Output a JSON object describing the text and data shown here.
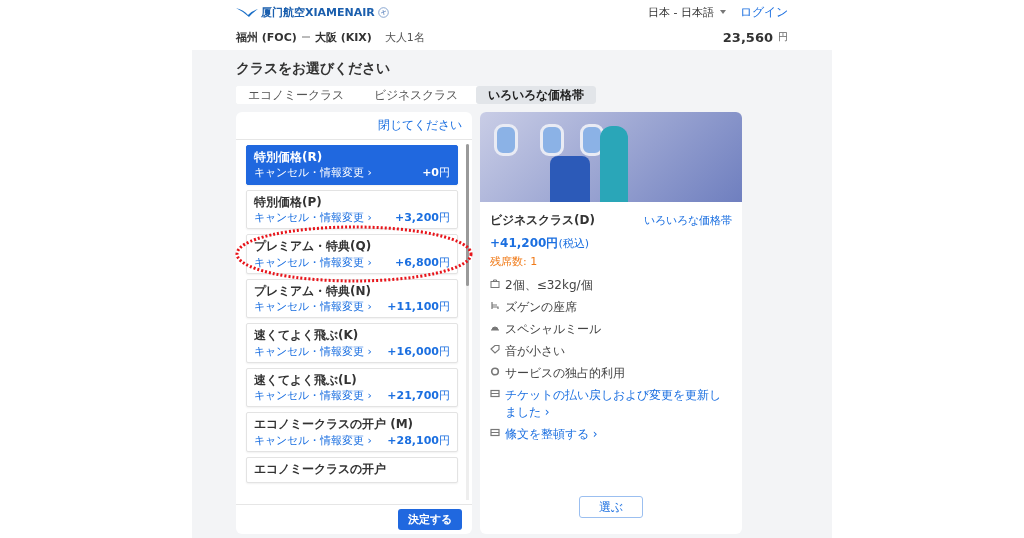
{
  "header": {
    "logo_text": "厦门航空XIAMENAIR",
    "language": "日本 - 日本語",
    "login": "ログイン"
  },
  "trip": {
    "origin": "福州 (FOC)",
    "destination": "大阪 (KIX)",
    "passengers": "大人1名",
    "total": "23,560",
    "currency": "円"
  },
  "title": "クラスをお選びください",
  "tabs": [
    {
      "label": "エコノミークラス",
      "selected": false
    },
    {
      "label": "ビジネスクラス",
      "selected": false
    },
    {
      "label": "いろいろな価格帯",
      "selected": true
    }
  ],
  "fare_panel": {
    "close_link": "閉じてください",
    "confirm_button": "決定する",
    "fares": [
      {
        "name": "特別価格(R)",
        "link": "キャンセル・情報変更 ›",
        "price": "+0",
        "unit": "円",
        "selected": true
      },
      {
        "name": "特別価格(P)",
        "link": "キャンセル・情報変更 ›",
        "price": "+3,200",
        "unit": "円",
        "selected": false
      },
      {
        "name": "プレミアム・特典(Q)",
        "link": "キャンセル・情報変更 ›",
        "price": "+6,800",
        "unit": "円",
        "selected": false
      },
      {
        "name": "プレミアム・特典(N)",
        "link": "キャンセル・情報変更 ›",
        "price": "+11,100",
        "unit": "円",
        "selected": false
      },
      {
        "name": "速くてよく飛ぶ(K)",
        "link": "キャンセル・情報変更 ›",
        "price": "+16,000",
        "unit": "円",
        "selected": false
      },
      {
        "name": "速くてよく飛ぶ(L)",
        "link": "キャンセル・情報変更 ›",
        "price": "+21,700",
        "unit": "円",
        "selected": false
      },
      {
        "name": "エコノミークラスの开户 (M)",
        "link": "キャンセル・情報変更 ›",
        "price": "+28,100",
        "unit": "円",
        "selected": false
      },
      {
        "name": "エコノミークラスの开户",
        "selected": false
      }
    ]
  },
  "detail": {
    "name": "ビジネスクラス(D)",
    "link": "いろいろな価格帯",
    "price": "+41,200円",
    "tax": "(税込)",
    "seats_left": "残席数: 1",
    "features": [
      {
        "kind": "feature",
        "text": "2個、≤32kg/個"
      },
      {
        "kind": "feature",
        "text": "ズゲンの座席"
      },
      {
        "kind": "feature",
        "text": "スペシャルミール"
      },
      {
        "kind": "feature",
        "text": "音が小さい"
      },
      {
        "kind": "feature",
        "text": "サービスの独占的利用"
      },
      {
        "kind": "link",
        "text": "チケットの払い戻しおよび変更を更新しました ›"
      },
      {
        "kind": "link",
        "text": "條文を整頓する ›"
      }
    ],
    "select_button": "選ぶ"
  }
}
